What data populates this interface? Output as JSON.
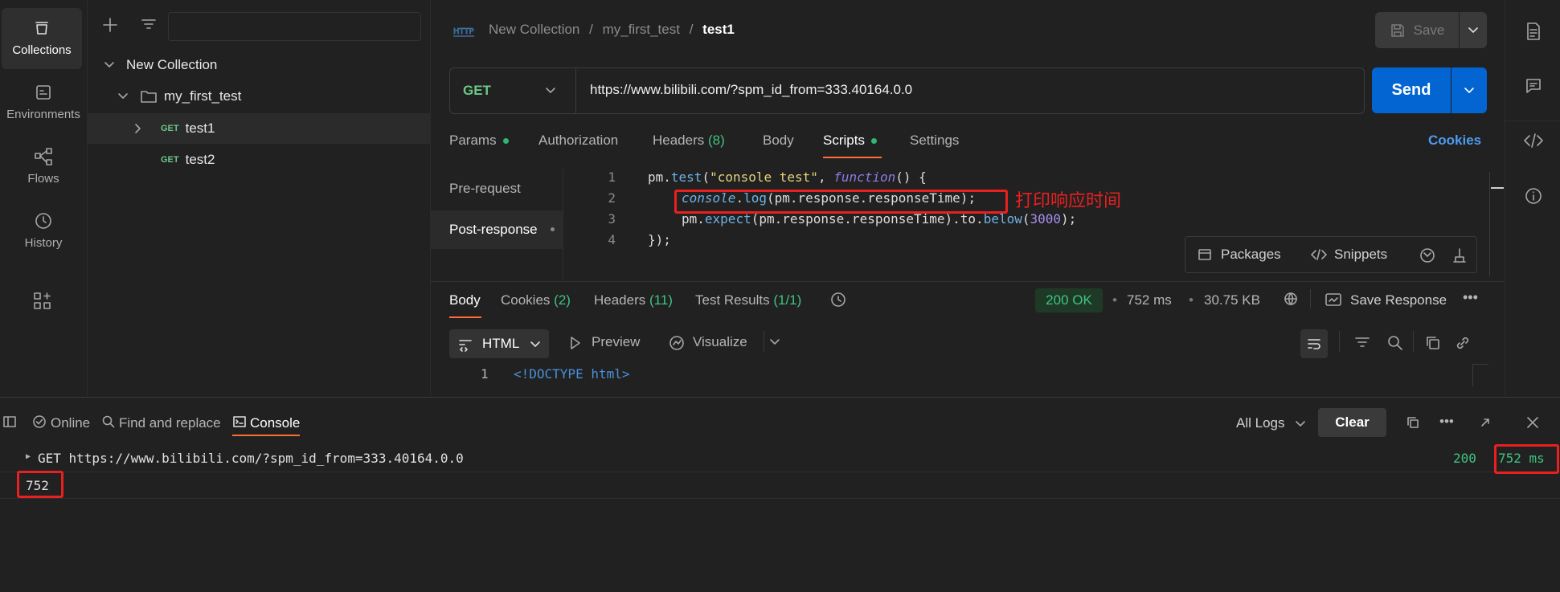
{
  "rail": {
    "items": [
      {
        "label": "Collections",
        "icon": "collections-icon"
      },
      {
        "label": "Environments",
        "icon": "environments-icon"
      },
      {
        "label": "Flows",
        "icon": "flows-icon"
      },
      {
        "label": "History",
        "icon": "history-icon"
      }
    ]
  },
  "sidebar": {
    "tree": {
      "collection": "New Collection",
      "folder": "my_first_test",
      "requests": [
        {
          "method": "GET",
          "name": "test1"
        },
        {
          "method": "GET",
          "name": "test2"
        }
      ]
    }
  },
  "header": {
    "breadcrumb": [
      "New Collection",
      "my_first_test",
      "test1"
    ],
    "http_badge": "HTTP",
    "save_label": "Save"
  },
  "request": {
    "method": "GET",
    "url": "https://www.bilibili.com/?spm_id_from=333.40164.0.0",
    "send_label": "Send"
  },
  "request_tabs": {
    "params": "Params",
    "authorization": "Authorization",
    "headers": "Headers",
    "headers_count": "(8)",
    "body": "Body",
    "scripts": "Scripts",
    "settings": "Settings",
    "cookies": "Cookies"
  },
  "scripts": {
    "pre_request": "Pre-request",
    "post_response": "Post-response",
    "lines": [
      "1",
      "2",
      "3",
      "4"
    ],
    "packages": "Packages",
    "snippets": "Snippets",
    "annotation": "打印响应时间"
  },
  "response": {
    "tabs": {
      "body": "Body",
      "cookies": "Cookies",
      "cookies_count": "(2)",
      "headers": "Headers",
      "headers_count": "(11)",
      "test_results": "Test Results",
      "test_results_count": "(1/1)"
    },
    "status": "200 OK",
    "time": "752 ms",
    "size": "30.75 KB",
    "save_response": "Save Response",
    "format": "HTML",
    "preview": "Preview",
    "visualize": "Visualize",
    "first_line_no": "1",
    "first_line": "<!DOCTYPE html>"
  },
  "console_bar": {
    "online": "Online",
    "find_replace": "Find and replace",
    "console": "Console",
    "all_logs": "All Logs",
    "clear": "Clear"
  },
  "console_log": {
    "request_line": "GET https://www.bilibili.com/?spm_id_from=333.40164.0.0",
    "status": "200",
    "time": "752 ms",
    "output": "752"
  },
  "colors": {
    "accent": "#ff6c37",
    "send_blue": "#0265d2",
    "ok_green": "#3fc380",
    "annotation_red": "#e8201f"
  }
}
